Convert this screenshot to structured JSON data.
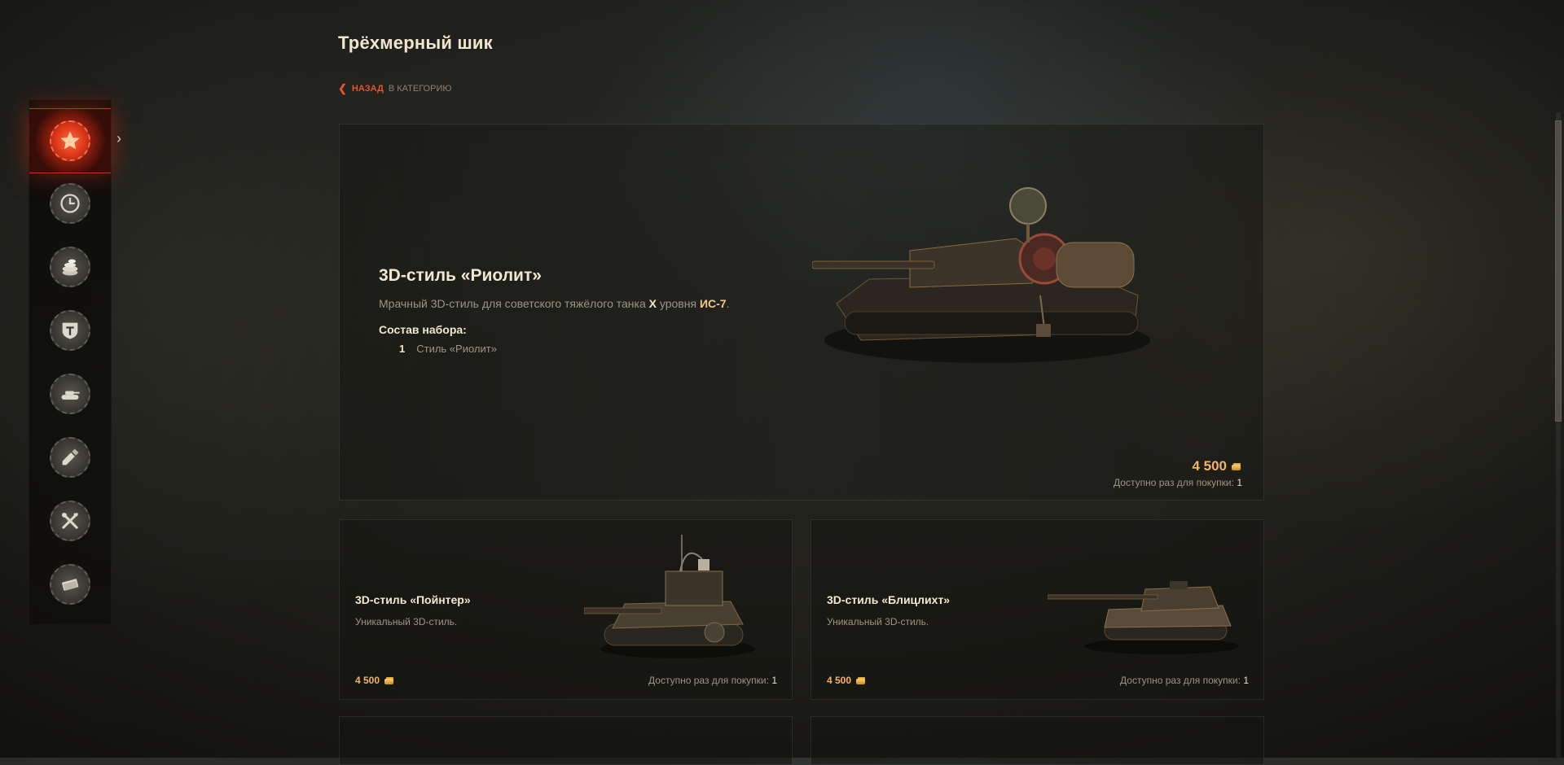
{
  "page": {
    "title": "Трёхмерный шик"
  },
  "breadcrumb": {
    "back_label": "НАЗАД",
    "category_label": "В КАТЕГОРИЮ"
  },
  "sidebar": {
    "items": [
      {
        "name": "featured",
        "icon": "star-icon",
        "active": true
      },
      {
        "name": "time-limited",
        "icon": "clock-icon",
        "active": false
      },
      {
        "name": "gold",
        "icon": "coins-icon",
        "active": false
      },
      {
        "name": "premium",
        "icon": "wot-logo-icon",
        "active": false
      },
      {
        "name": "vehicles",
        "icon": "tank-icon",
        "active": false
      },
      {
        "name": "customization",
        "icon": "paint-icon",
        "active": false
      },
      {
        "name": "equipment",
        "icon": "tools-icon",
        "active": false
      },
      {
        "name": "credits",
        "icon": "money-stack-icon",
        "active": false
      }
    ]
  },
  "main_offer": {
    "title": "3D-стиль «Риолит»",
    "desc_prefix": "Мрачный 3D-стиль для советского тяжёлого танка ",
    "tier": "X",
    "desc_mid": " уровня ",
    "tank": "ИС-7",
    "desc_suffix": ".",
    "set_label": "Состав набора:",
    "set_qty": "1",
    "set_item": "Стиль «Риолит»",
    "price": "4 500",
    "avail_label": "Доступно раз для покупки:",
    "avail_count": "1"
  },
  "offers": [
    {
      "title": "3D-стиль «Пойнтер»",
      "desc": "Уникальный 3D-стиль.",
      "price": "4 500",
      "avail_label": "Доступно раз для покупки:",
      "avail_count": "1"
    },
    {
      "title": "3D-стиль «Блицлихт»",
      "desc": "Уникальный 3D-стиль.",
      "price": "4 500",
      "avail_label": "Доступно раз для покупки:",
      "avail_count": "1"
    }
  ],
  "colors": {
    "accent": "#e0552a",
    "gold": "#f2b46a",
    "active_nav": "#c42a14"
  }
}
